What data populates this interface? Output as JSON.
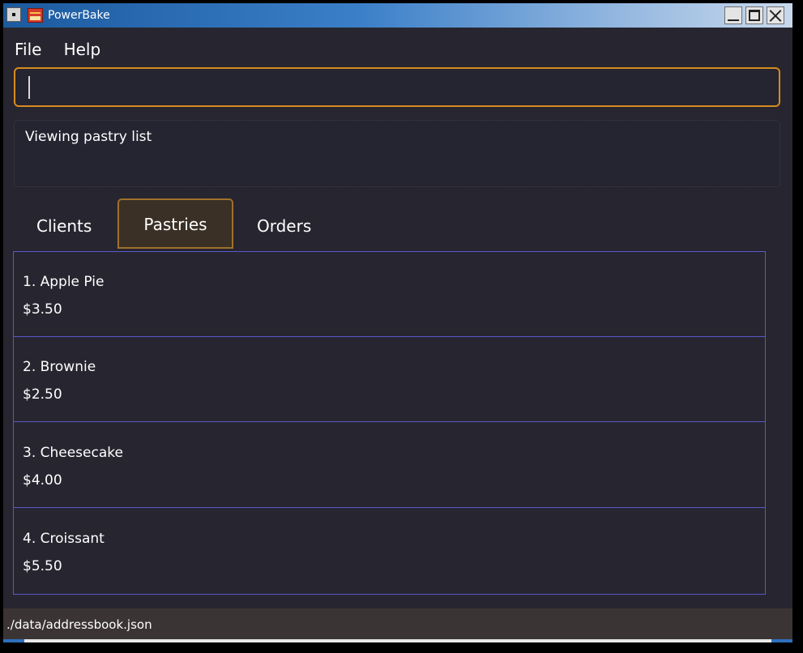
{
  "window": {
    "title": "PowerBake"
  },
  "menu": {
    "items": [
      {
        "label": "File"
      },
      {
        "label": "Help"
      }
    ]
  },
  "command": {
    "value": "",
    "placeholder": ""
  },
  "result": {
    "text": "Viewing pastry list"
  },
  "tabs": [
    {
      "label": "Clients",
      "selected": false
    },
    {
      "label": "Pastries",
      "selected": true
    },
    {
      "label": "Orders",
      "selected": false
    }
  ],
  "pastries": [
    {
      "name": "1.  Apple Pie",
      "price": "$3.50"
    },
    {
      "name": "2.  Brownie",
      "price": "$2.50"
    },
    {
      "name": "3.  Cheesecake",
      "price": "$4.00"
    },
    {
      "name": "4.  Croissant",
      "price": "$5.50"
    }
  ],
  "status": {
    "file_path": "./data/addressbook.json"
  },
  "colors": {
    "background": "#272630",
    "accent": "#d68b1d",
    "list_border": "#5b57c9",
    "status_bar": "#3b3434"
  },
  "icons": {
    "system_menu": "system-menu-icon",
    "app": "powerbake-app-icon",
    "minimize": "minimize-icon",
    "maximize": "maximize-icon",
    "close": "close-icon"
  }
}
